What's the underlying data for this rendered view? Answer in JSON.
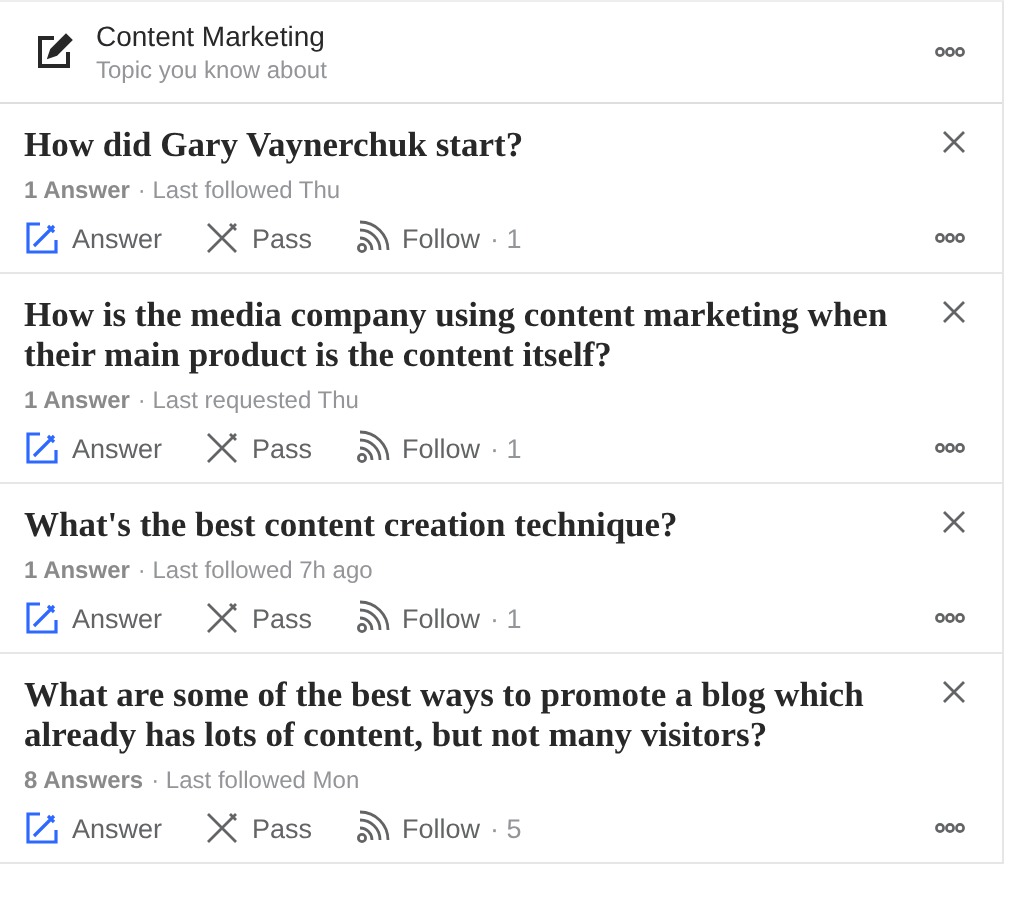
{
  "topic": {
    "title": "Content Marketing",
    "subtitle": "Topic you know about"
  },
  "questions": [
    {
      "title": "How did Gary Vaynerchuk start?",
      "answers": "1 Answer",
      "activity": "· Last followed Thu",
      "actions": {
        "answer": "Answer",
        "pass": "Pass",
        "follow": "Follow",
        "follow_count": "· 1"
      }
    },
    {
      "title": "How is the media company using content marketing when their main product is the content itself?",
      "answers": "1 Answer",
      "activity": "· Last requested Thu",
      "actions": {
        "answer": "Answer",
        "pass": "Pass",
        "follow": "Follow",
        "follow_count": "· 1"
      }
    },
    {
      "title": "What's the best content creation technique?",
      "answers": "1 Answer",
      "activity": "· Last followed 7h ago",
      "actions": {
        "answer": "Answer",
        "pass": "Pass",
        "follow": "Follow",
        "follow_count": "· 1"
      }
    },
    {
      "title": "What are some of the best ways to promote a blog which already has lots of content, but not many visitors?",
      "answers": "8 Answers",
      "activity": "· Last followed Mon",
      "actions": {
        "answer": "Answer",
        "pass": "Pass",
        "follow": "Follow",
        "follow_count": "· 5"
      }
    }
  ]
}
